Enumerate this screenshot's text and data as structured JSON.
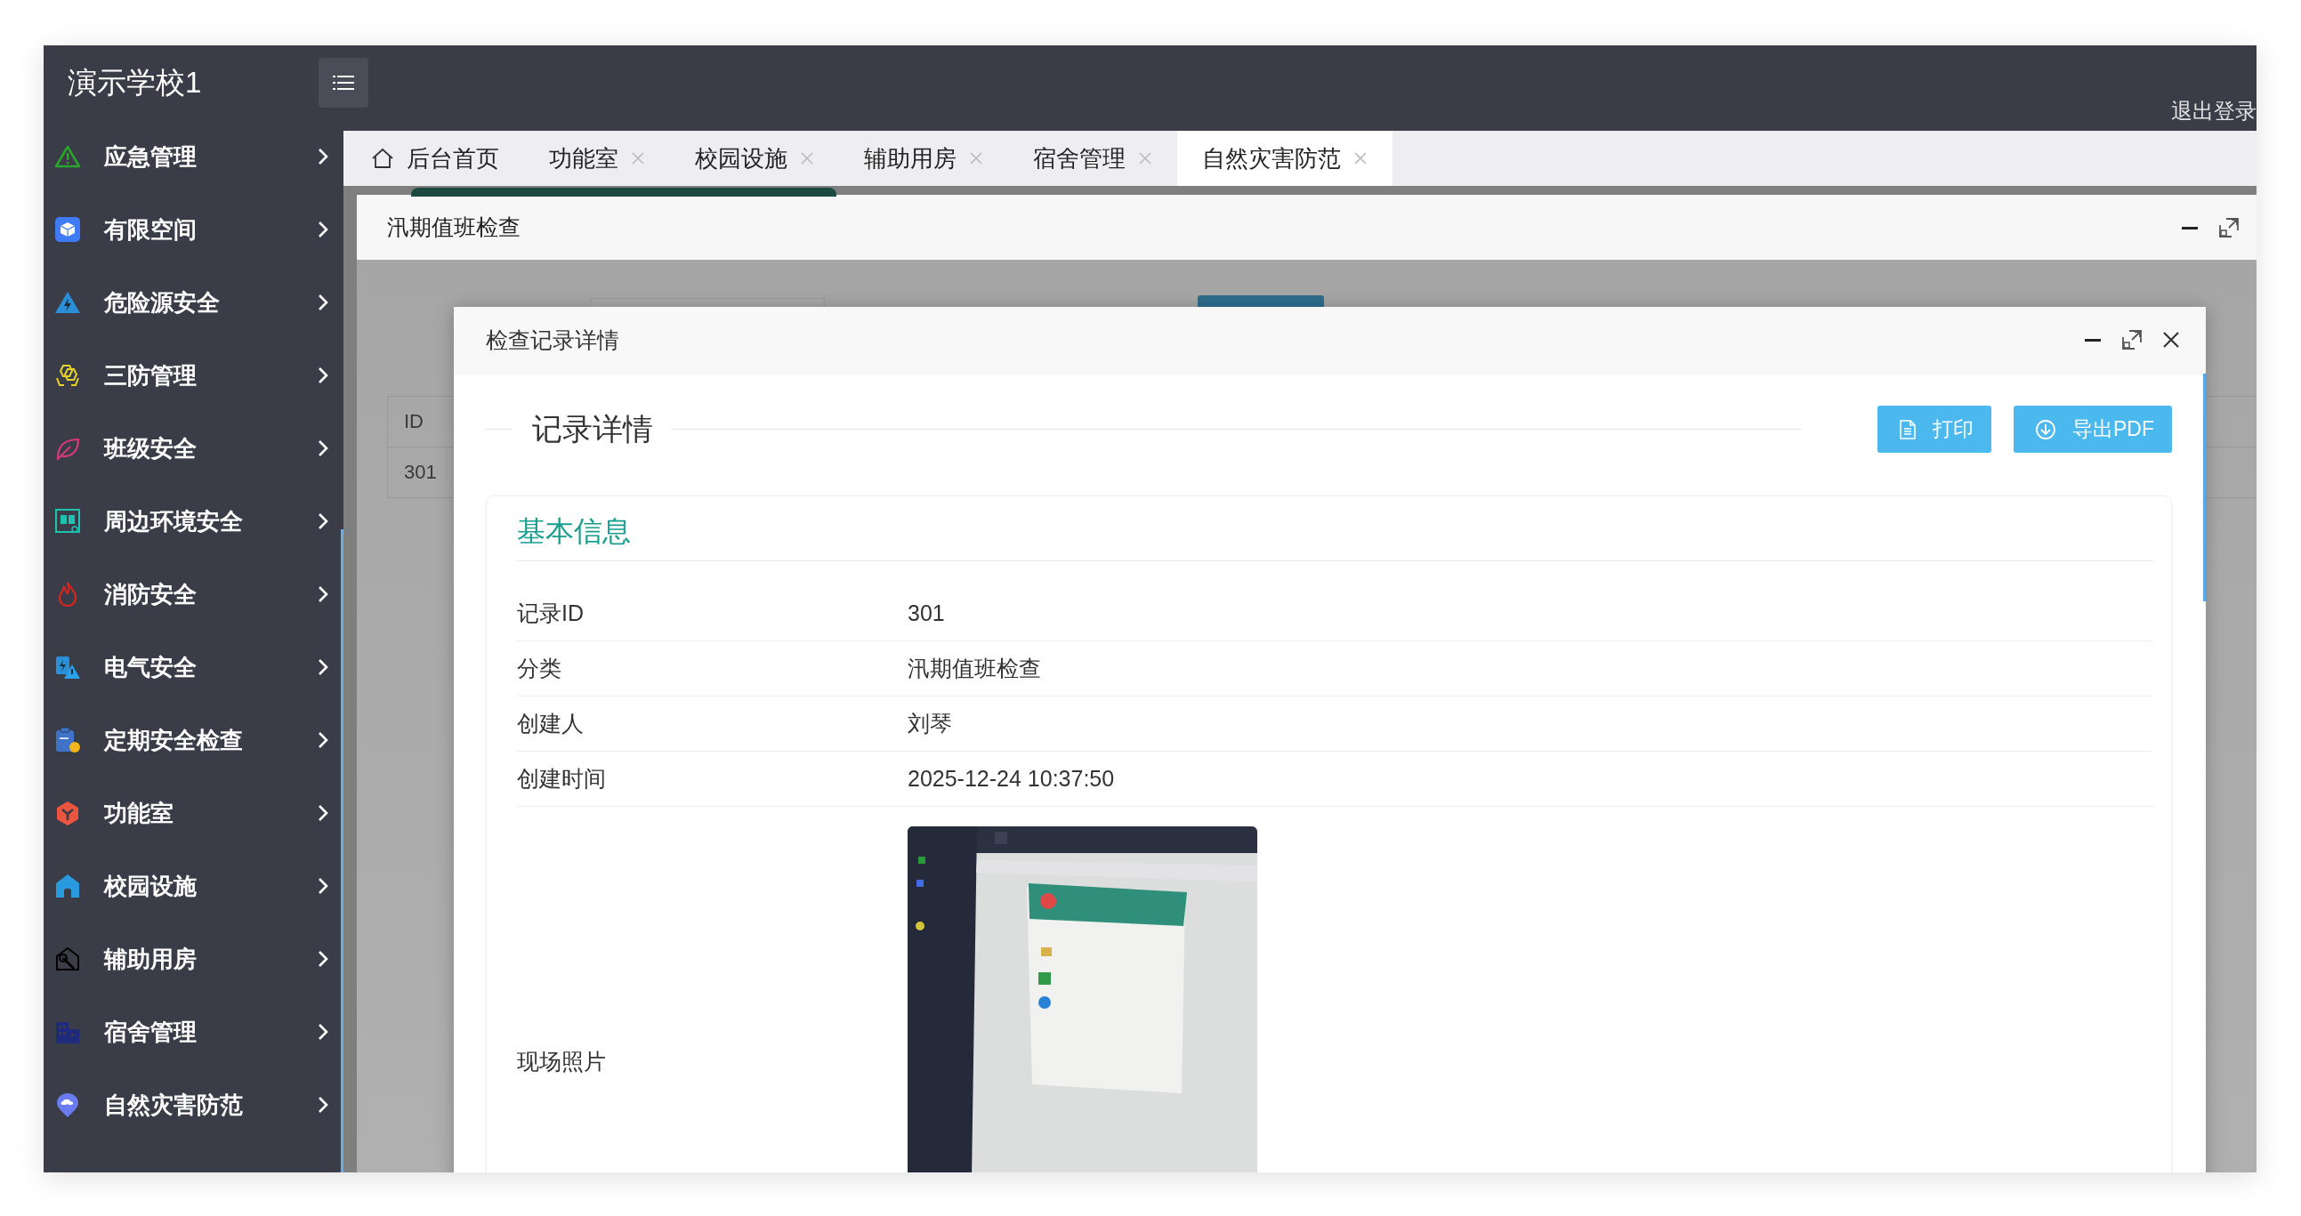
{
  "header": {
    "school_name": "演示学校1",
    "logout": "退出登录"
  },
  "sidebar": {
    "items": [
      {
        "label": "应急管理"
      },
      {
        "label": "有限空间"
      },
      {
        "label": "危险源安全"
      },
      {
        "label": "三防管理"
      },
      {
        "label": "班级安全"
      },
      {
        "label": "周边环境安全"
      },
      {
        "label": "消防安全"
      },
      {
        "label": "电气安全"
      },
      {
        "label": "定期安全检查"
      },
      {
        "label": "功能室"
      },
      {
        "label": "校园设施"
      },
      {
        "label": "辅助用房"
      },
      {
        "label": "宿舍管理"
      },
      {
        "label": "自然灾害防范"
      }
    ]
  },
  "tabs": [
    {
      "label": "后台首页",
      "kind": "home",
      "selected": false
    },
    {
      "label": "功能室",
      "kind": "page",
      "selected": false
    },
    {
      "label": "校园设施",
      "kind": "page",
      "selected": false
    },
    {
      "label": "辅助用房",
      "kind": "page",
      "selected": false
    },
    {
      "label": "宿舍管理",
      "kind": "page",
      "selected": false
    },
    {
      "label": "自然灾害防范",
      "kind": "page",
      "selected": true
    }
  ],
  "panel": {
    "title": "汛期值班检查",
    "background_table": {
      "columns": [
        "ID"
      ],
      "rows": [
        [
          "301"
        ]
      ]
    }
  },
  "modal": {
    "title": "检查记录详情",
    "section_title": "记录详情",
    "buttons": [
      {
        "label": "打印",
        "kind": "print"
      },
      {
        "label": "导出PDF",
        "kind": "export"
      }
    ],
    "card_title": "基本信息",
    "fields": [
      {
        "label": "记录ID",
        "kind": "text",
        "value": "301"
      },
      {
        "label": "分类",
        "kind": "text",
        "value": "汛期值班检查"
      },
      {
        "label": "创建人",
        "kind": "text",
        "value": "刘琴"
      },
      {
        "label": "创建时间",
        "kind": "text",
        "value": "2025-12-24 10:37:50"
      },
      {
        "label": "现场照片"
      }
    ]
  }
}
